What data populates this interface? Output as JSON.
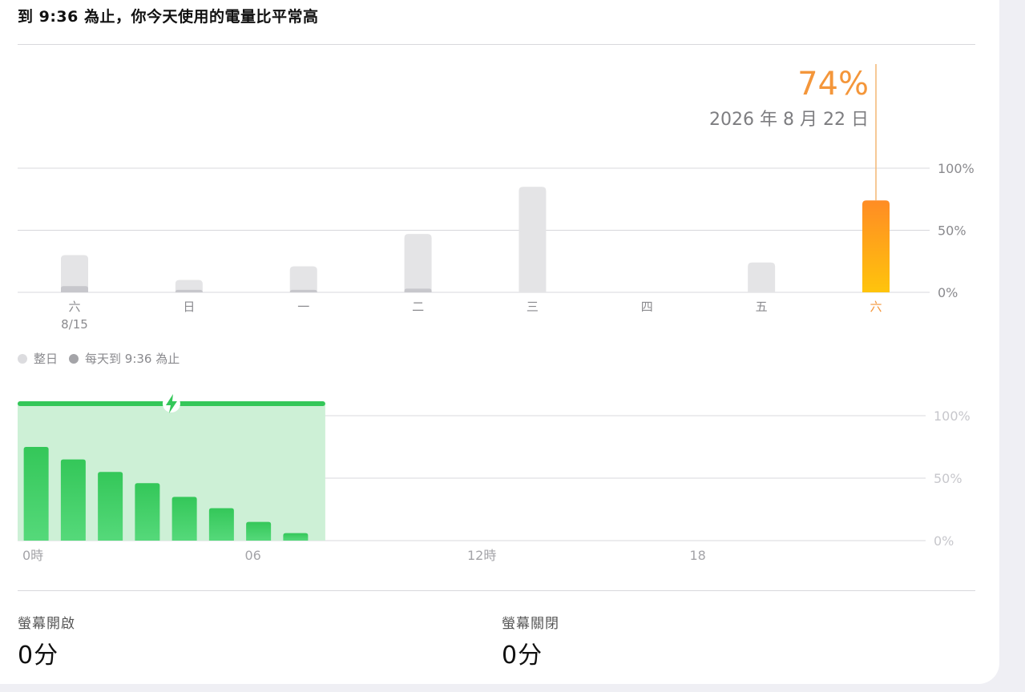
{
  "headline": "到 9:36 為止，你今天使用的電量比平常高",
  "callout": {
    "percent": "74%",
    "date": "2026 年 8 月 22 日"
  },
  "colors": {
    "accent": "#ff9f0a",
    "accent_light": "#ffc40c",
    "gray_bar": "#e4e4e6",
    "gray_bar_dark": "#c7c7cc",
    "green": "#34c759",
    "green_fill": "#cdf0d6",
    "grid": "#d8d8dc"
  },
  "legend": {
    "whole_day": "整日",
    "until_now": "每天到 9:36 為止"
  },
  "charts_meta": {
    "top_y_ticks": [
      "100%",
      "50%",
      "0%"
    ],
    "bottom_y_ticks": [
      "100%",
      "50%",
      "0%"
    ]
  },
  "chart_data": [
    {
      "type": "bar",
      "categories": [
        "六",
        "日",
        "一",
        "二",
        "三",
        "四",
        "五",
        "六"
      ],
      "sub_labels": [
        "8/15",
        "",
        "",
        "",
        "",
        "",
        "",
        ""
      ],
      "selected_index": 7,
      "series": [
        {
          "name": "整日",
          "values": [
            30,
            10,
            21,
            47,
            85,
            0,
            24,
            74
          ]
        },
        {
          "name": "每天到 9:36 為止",
          "values": [
            5,
            2,
            2,
            3,
            0,
            0,
            0,
            74
          ]
        }
      ],
      "ylim": [
        0,
        100
      ],
      "grid": true
    },
    {
      "type": "bar",
      "categories": [
        "0時",
        "",
        "",
        "",
        "",
        "",
        "06",
        "",
        "",
        "",
        "",
        "",
        "12時",
        "",
        "",
        "",
        "",
        "",
        "18",
        "",
        "",
        "",
        "",
        ""
      ],
      "x_tick_labels": [
        "0時",
        "06",
        "12時",
        "18"
      ],
      "values": [
        75,
        65,
        55,
        46,
        35,
        26,
        15,
        6
      ],
      "charging_hours": [
        0,
        8.3
      ],
      "ylim": [
        0,
        100
      ],
      "grid": true
    }
  ],
  "stats": {
    "screen_on_label": "螢幕開啟",
    "screen_on_value": "0分",
    "screen_off_label": "螢幕關閉",
    "screen_off_value": "0分"
  }
}
